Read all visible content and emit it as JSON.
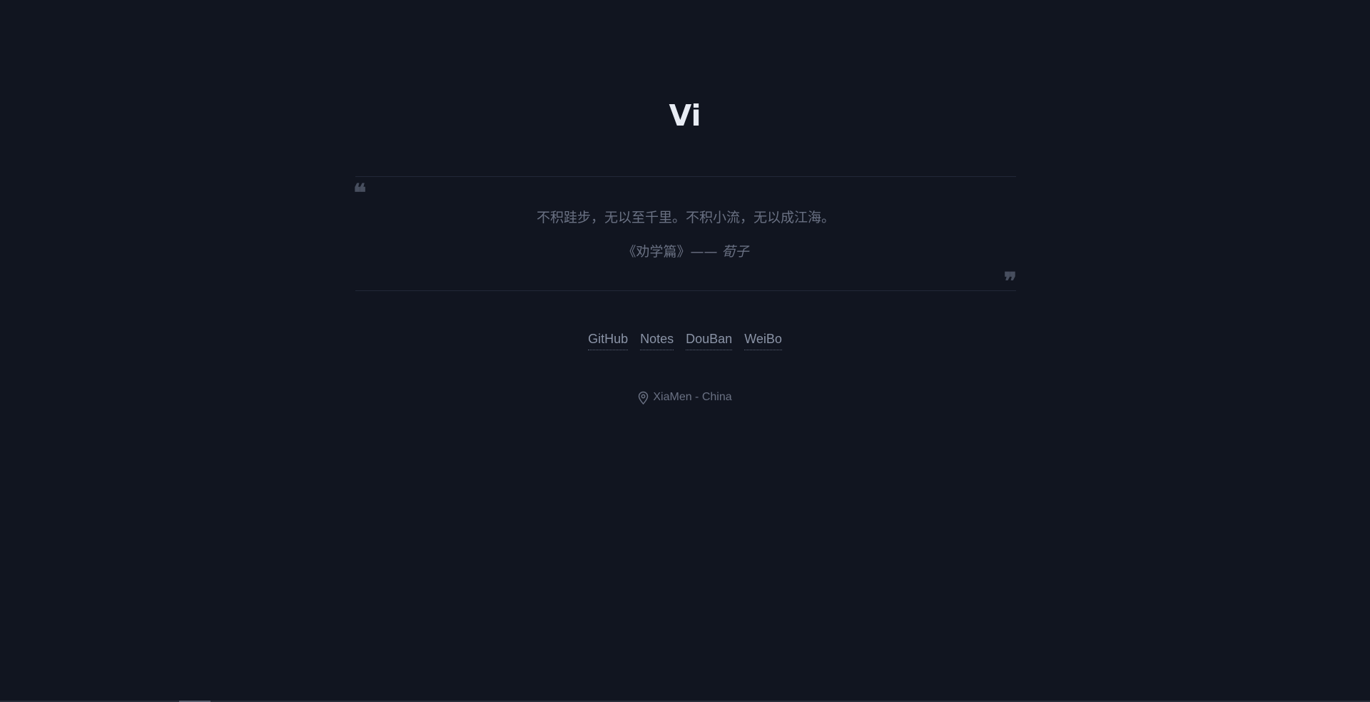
{
  "site": {
    "title": "Vi"
  },
  "quote": {
    "open_mark": "❝",
    "close_mark": "❞",
    "text": "不积跬步，无以至千里。不积小流，无以成江海。",
    "source": "《劝学篇》——",
    "author": "荀子"
  },
  "links": [
    {
      "label": "GitHub"
    },
    {
      "label": "Notes"
    },
    {
      "label": "DouBan"
    },
    {
      "label": "WeiBo"
    }
  ],
  "location": {
    "icon": "map-pin-icon",
    "text": "XiaMen - China"
  },
  "colors": {
    "background": "#111520",
    "title": "#e8ecf4",
    "muted_text": "#6a7183",
    "link": "#8a93a6"
  }
}
